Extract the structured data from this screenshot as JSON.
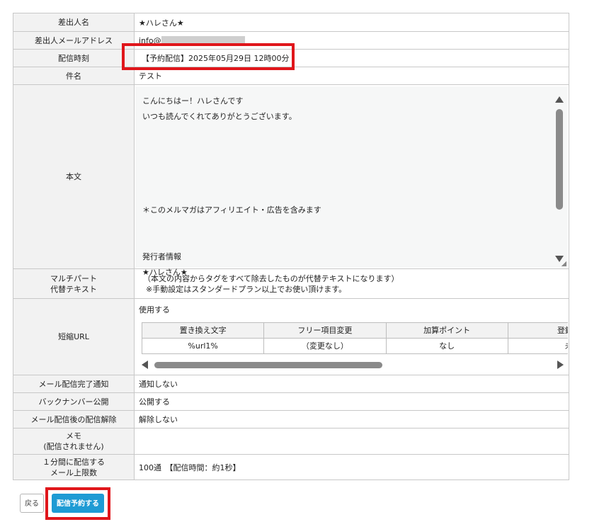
{
  "form": {
    "sender_name": {
      "label": "差出人名",
      "value": "★ハレさん★"
    },
    "sender_email": {
      "label": "差出人メールアドレス",
      "value": "info@"
    },
    "schedule": {
      "label": "配信時刻",
      "value": "【予約配信】2025年05月29日 12時00分"
    },
    "subject": {
      "label": "件名",
      "value": "テスト"
    },
    "body": {
      "label": "本文",
      "lines": [
        "こんにちはー！ハレさんです",
        "いつも読んでくれてありがとうございます。",
        "",
        "",
        "",
        "",
        "",
        "＊このメルマガはアフィリエイト・広告を含みます",
        "",
        "",
        "発行者情報",
        "★ハレさん★"
      ]
    },
    "multipart": {
      "label_line1": "マルチパート",
      "label_line2": "代替テキスト",
      "note1": "（本文の内容からタグをすべて除去したものが代替テキストになります）",
      "note2": "※手動設定はスタンダードプラン以上でお使い頂けます。"
    },
    "short_url": {
      "label": "短縮URL",
      "status": "使用する",
      "headers": [
        "置き換え文字",
        "フリー項目変更",
        "加算ポイント",
        "登録先"
      ],
      "row": [
        "%url1%",
        "（変更なし）",
        "なし",
        "未"
      ]
    },
    "completion_notice": {
      "label": "メール配信完了通知",
      "value": "通知しない"
    },
    "backnumber": {
      "label": "バックナンバー公開",
      "value": "公開する"
    },
    "unsubscribe": {
      "label": "メール配信後の配信解除",
      "value": "解除しない"
    },
    "memo": {
      "label_line1": "メモ",
      "label_line2": "(配信されません)",
      "value": ""
    },
    "rate": {
      "label_line1": "１分間に配信する",
      "label_line2": "メール上限数",
      "value": "100通　【配信時間：約1秒】"
    }
  },
  "buttons": {
    "back": "戻る",
    "schedule_send": "配信予約する"
  },
  "colors": {
    "highlight": "#e0161b",
    "primary_button": "#1e9bd4"
  }
}
